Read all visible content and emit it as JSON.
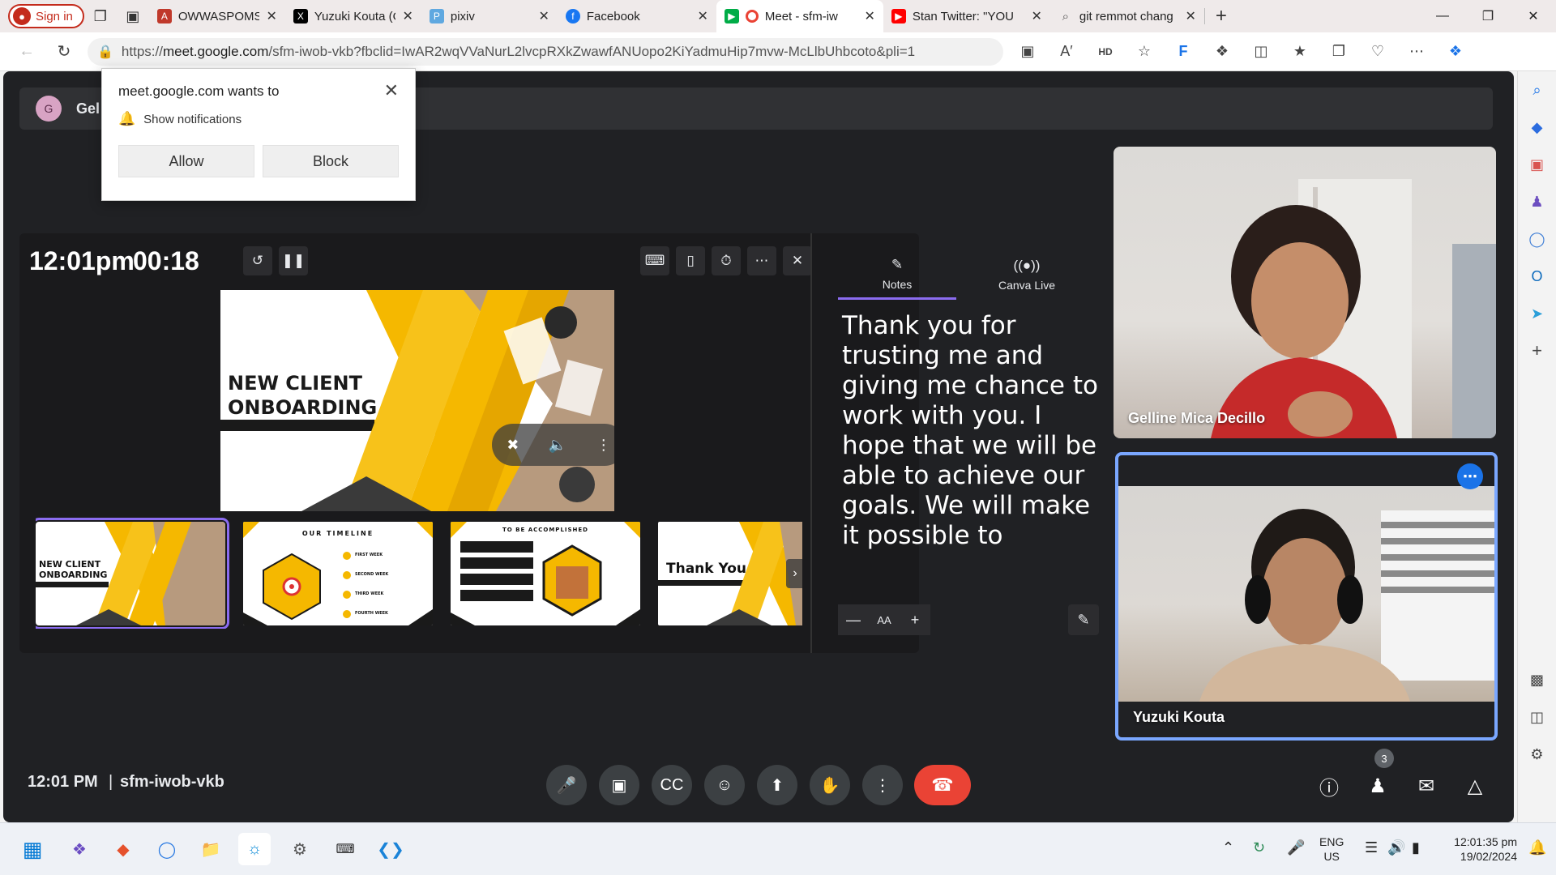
{
  "browser": {
    "signin_label": "Sign in",
    "tabs": [
      {
        "title": "OWWASPOMS (Sc",
        "fav": "A",
        "color": "#c0392b"
      },
      {
        "title": "Yuzuki Kouta (OPE",
        "fav": "X",
        "color": "#000000"
      },
      {
        "title": "pixiv",
        "fav": "P",
        "color": "#5fa8e0"
      },
      {
        "title": "Facebook",
        "fav": "f",
        "color": "#1877f2"
      },
      {
        "title": "Meet - sfm-iw",
        "fav": "▶",
        "color": "#ea4335"
      },
      {
        "title": "Stan Twitter: \"YOU",
        "fav": "▶",
        "color": "#ff0000"
      },
      {
        "title": "git remmot chang",
        "fav": "⌕",
        "color": "#888888"
      }
    ],
    "url_prefix": "https://",
    "url_host": "meet.google.com",
    "url_path": "/sfm-iwob-vkb?fbclid=IwAR2wqVVaNurL2lvcpRXkZwawfANUopo2KiYadmuHip7mvw-McLlbUhbcoto&pli=1"
  },
  "popup": {
    "heading": "meet.google.com wants to",
    "permission": "Show notifications",
    "allow": "Allow",
    "block": "Block"
  },
  "meet": {
    "presenter_initial": "G",
    "presenter_name_partial": "Gel",
    "clock": "12:01pm",
    "timer": "00:18",
    "main_slide": {
      "line1": "NEW CLIENT",
      "line2": "ONBOARDING"
    },
    "thumbnails": [
      {
        "line1": "NEW CLIENT",
        "line2": "ONBOARDING"
      },
      {
        "title": "OUR TIMELINE",
        "items": [
          "FIRST WEEK",
          "SECOND WEEK",
          "THIRD WEEK",
          "FOURTH WEEK"
        ]
      },
      {
        "title": "TO BE ACCOMPLISHED"
      },
      {
        "title": "Thank You"
      }
    ],
    "notes_tab": "Notes",
    "canva_tab": "Canva Live",
    "notes_text": "Thank you for trusting me and giving me chance to work with you. I hope that we will be able to achieve our goals. We will make it possible to",
    "font_size_label": "AA",
    "participants": [
      {
        "name": "Gelline Mica Decillo"
      },
      {
        "name": "Yuzuki Kouta"
      }
    ],
    "bottom_time": "12:01 PM",
    "meeting_code": "sfm-iwob-vkb",
    "people_count": "3"
  },
  "taskbar": {
    "lang": "ENG",
    "region": "US",
    "time": "12:01:35 pm",
    "date": "19/02/2024"
  },
  "colors": {
    "accent": "#8b6cf0",
    "end_call": "#ea4335",
    "slide_yellow": "#f5b800",
    "active_tile": "#7aa7ff"
  }
}
